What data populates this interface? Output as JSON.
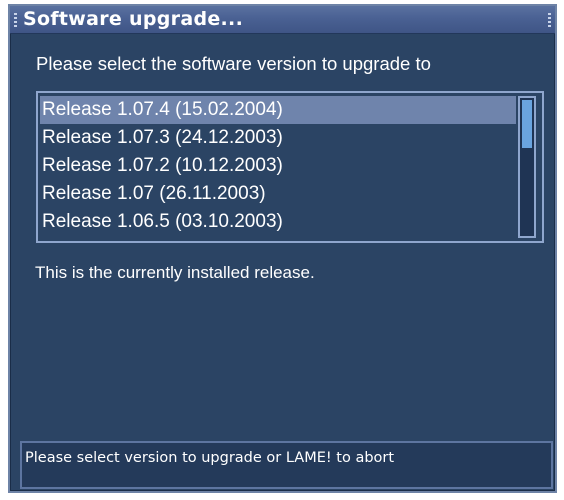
{
  "window": {
    "title": "Software upgrade..."
  },
  "prompt": "Please select the software version to upgrade to",
  "releases": [
    {
      "label": "Release 1.07.4  (15.02.2004)",
      "selected": true
    },
    {
      "label": "Release 1.07.3  (24.12.2003)",
      "selected": false
    },
    {
      "label": "Release 1.07.2  (10.12.2003)",
      "selected": false
    },
    {
      "label": "Release 1.07  (26.11.2003)",
      "selected": false
    },
    {
      "label": "Release 1.06.5  (03.10.2003)",
      "selected": false
    }
  ],
  "status": "This is the currently installed release.",
  "hint": "Please select version to upgrade or LAME! to abort",
  "colors": {
    "panel": "#2b4464",
    "titlebar": "#4a6193",
    "selection": "#6f84ac",
    "scroll_thumb": "#6aa4df",
    "text": "#ffffff"
  }
}
